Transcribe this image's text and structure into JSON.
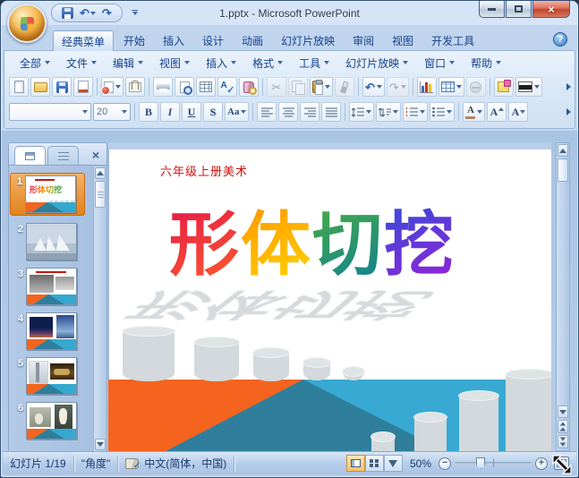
{
  "window": {
    "title": "1.pptx - Microsoft PowerPoint"
  },
  "icons": {
    "close_window": "×",
    "help": "?",
    "undo": "↶",
    "redo": "↷",
    "scissors": "✂",
    "check": "✓",
    "spell_a": "A",
    "close_panel": "×",
    "font_a": "A",
    "minus": "−",
    "plus": "+"
  },
  "ribbon": {
    "tabs": [
      {
        "label": "经典菜单",
        "active": true
      },
      {
        "label": "开始"
      },
      {
        "label": "插入"
      },
      {
        "label": "设计"
      },
      {
        "label": "动画"
      },
      {
        "label": "幻灯片放映"
      },
      {
        "label": "审阅"
      },
      {
        "label": "视图"
      },
      {
        "label": "开发工具"
      }
    ]
  },
  "menubar": {
    "items": [
      {
        "label": "全部"
      },
      {
        "label": "文件"
      },
      {
        "label": "编辑"
      },
      {
        "label": "视图"
      },
      {
        "label": "插入"
      },
      {
        "label": "格式"
      },
      {
        "label": "工具"
      },
      {
        "label": "幻灯片放映"
      },
      {
        "label": "窗口"
      },
      {
        "label": "帮助"
      }
    ]
  },
  "toolbar": {
    "font_name": "",
    "font_size": "20",
    "format_buttons": [
      "B",
      "I",
      "U",
      "S",
      "Aa"
    ]
  },
  "panel": {
    "slides": [
      {
        "num": "1",
        "selected": true
      },
      {
        "num": "2"
      },
      {
        "num": "3"
      },
      {
        "num": "4"
      },
      {
        "num": "5"
      },
      {
        "num": "6"
      }
    ]
  },
  "slide": {
    "course_label": "六年级上册美术",
    "title_text": "形体切挖",
    "title_chars": [
      {
        "ch": "形",
        "from": "#e2104c",
        "to": "#ff5f2a"
      },
      {
        "ch": "体",
        "from": "#ff8d00",
        "to": "#ffd800"
      },
      {
        "ch": "切",
        "from": "#52b23c",
        "to": "#0a7e95"
      },
      {
        "ch": "挖",
        "from": "#2a52d8",
        "to": "#9a1fd8"
      }
    ]
  },
  "statusbar": {
    "slide_indicator": "幻灯片 1/19",
    "theme_name": "\"角度\"",
    "language": "中文(简体，中国)",
    "zoom_level": "50%"
  }
}
